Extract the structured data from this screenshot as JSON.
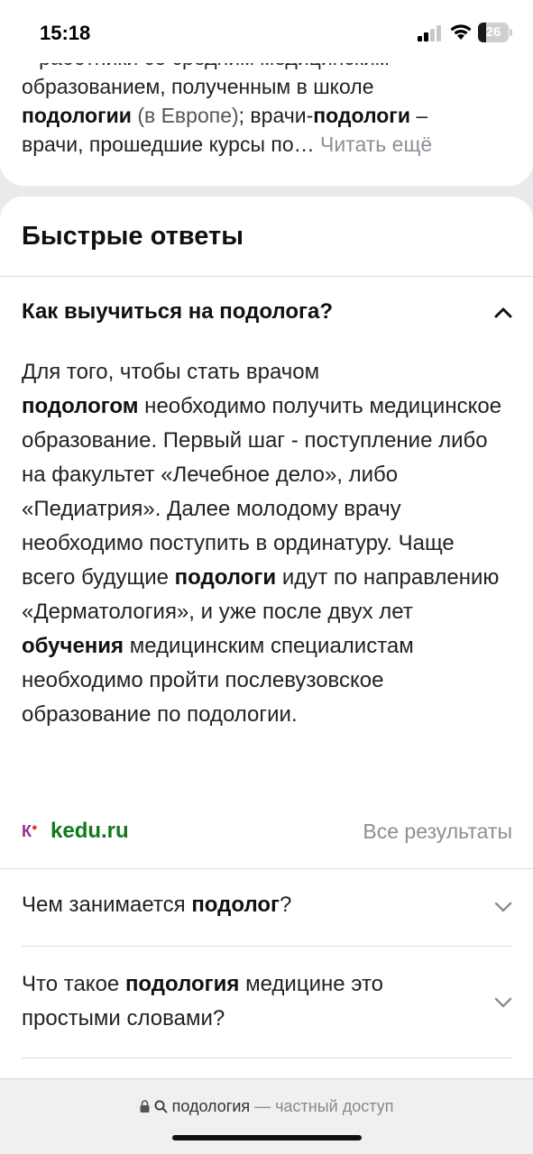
{
  "status_bar": {
    "time": "15:18",
    "battery": "26",
    "battery_level": 0.26
  },
  "snippet": {
    "line0": "– работники со средним медицинским",
    "line1": "образованием, полученным в школе",
    "line2_bold": "подологии",
    "line2_muted": " (в Европе)",
    "line2_rest": "; врачи-",
    "line2_bold2": "подологи",
    "line2_end": " –",
    "line3": "врачи, прошедшие курсы по…",
    "read_more": "Читать ещё"
  },
  "quick_answers": {
    "title": "Быстрые ответы",
    "open_question": "Как выучиться на подолога?",
    "answer": {
      "p1": "Для того, чтобы стать врачом",
      "b1": "подологом",
      "p2": " необходимо получить медицинское образование. Первый шаг - поступление либо на факультет «Лечебное дело», либо «Педиатрия». Далее молодому врачу необходимо поступить в ординатуру. Чаще всего будущие ",
      "b2": "подологи",
      "p3": " идут по направлению «Дерматология», и уже после двух лет ",
      "b3": "обучения",
      "p4": " медицинским специалистам необходимо пройти послевузовское образование по подологии."
    },
    "source_logo": "К",
    "source": "kedu.ru",
    "all_results": "Все результаты",
    "questions": [
      {
        "pre": "Чем занимается ",
        "bold": "подолог",
        "post": "?"
      },
      {
        "pre": "Что такое ",
        "bold": "подология",
        "post": " медицине это простыми словами?"
      }
    ]
  },
  "address_bar": {
    "query": "подология",
    "suffix": "— частный доступ"
  },
  "icons": [
    "signal-icon",
    "wifi-icon",
    "battery-icon",
    "chevron-up-icon",
    "chevron-down-icon",
    "lock-icon",
    "search-icon"
  ]
}
